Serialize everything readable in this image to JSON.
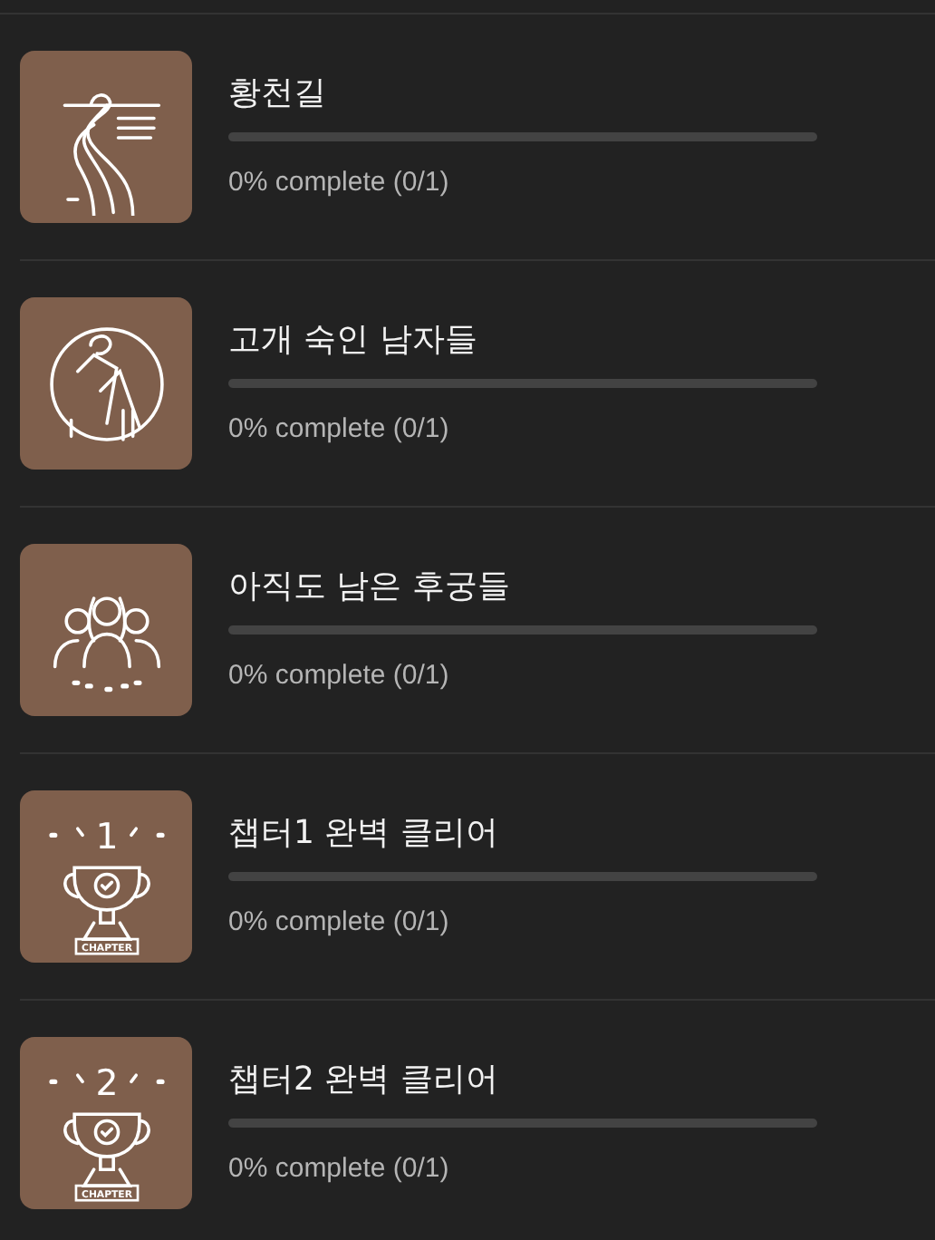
{
  "achievements": [
    {
      "kind": "road",
      "title": "황천길",
      "level": 0,
      "progress": "0% complete (0/1)"
    },
    {
      "kind": "man",
      "title": "고개 숙인 남자들",
      "level": 0,
      "progress": "0% complete (0/1)"
    },
    {
      "kind": "women",
      "title": "아직도 남은 후궁들",
      "level": 0,
      "progress": "0% complete (0/1)"
    },
    {
      "kind": "trophy",
      "badge_number": "1",
      "badge_label": "CHAPTER",
      "title": "챕터1 완벽 클리어",
      "level": 0,
      "progress": "0% complete (0/1)"
    },
    {
      "kind": "trophy",
      "badge_number": "2",
      "badge_label": "CHAPTER",
      "title": "챕터2 완벽 클리어",
      "level": 0,
      "progress": "0% complete (0/1)"
    }
  ]
}
